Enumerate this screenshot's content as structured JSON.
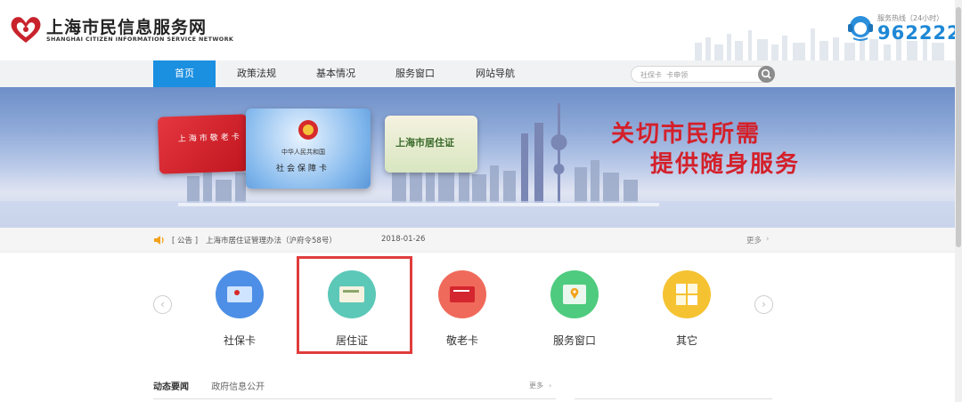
{
  "header": {
    "site_title": "上海市民信息服务网",
    "site_subtitle": "SHANGHAI CITIZEN INFORMATION SERVICE NETWORK",
    "hotline_label": "服务热线（24小时）",
    "hotline_number": "962222",
    "icons": [
      "heart-logo-icon",
      "headset-icon"
    ]
  },
  "nav": {
    "items": [
      {
        "label": "首页",
        "active": true
      },
      {
        "label": "政策法规",
        "active": false
      },
      {
        "label": "基本情况",
        "active": false
      },
      {
        "label": "服务窗口",
        "active": false
      },
      {
        "label": "网站导航",
        "active": false
      }
    ],
    "search_placeholder": "社保卡  卡申领"
  },
  "banner": {
    "card_red_title": "上海市敬老卡",
    "card_blue_line1": "中华人民共和国",
    "card_blue_line2": "社会保障卡",
    "card_green_title": "上海市居住证",
    "slogan_line1": "关切市民所需",
    "slogan_line2": "提供随身服务"
  },
  "notice": {
    "tag": "[ 公告 ]",
    "text": "上海市居住证管理办法（沪府令58号）",
    "date": "2018-01-26",
    "more": "更多"
  },
  "services": [
    {
      "label": "社保卡",
      "color": "#4d8fe6"
    },
    {
      "label": "居住证",
      "color": "#5cc8b8"
    },
    {
      "label": "敬老卡",
      "color": "#ef6a5a"
    },
    {
      "label": "服务窗口",
      "color": "#4ecb7e"
    },
    {
      "label": "其它",
      "color": "#f5c232"
    }
  ],
  "news": {
    "tab_active": "动态要闻",
    "tab_inactive": "政府信息公开",
    "more": "更多"
  },
  "colors": {
    "accent": "#1b8fe0",
    "highlight_box": "#e03c3c",
    "slogan": "#d4202a"
  }
}
